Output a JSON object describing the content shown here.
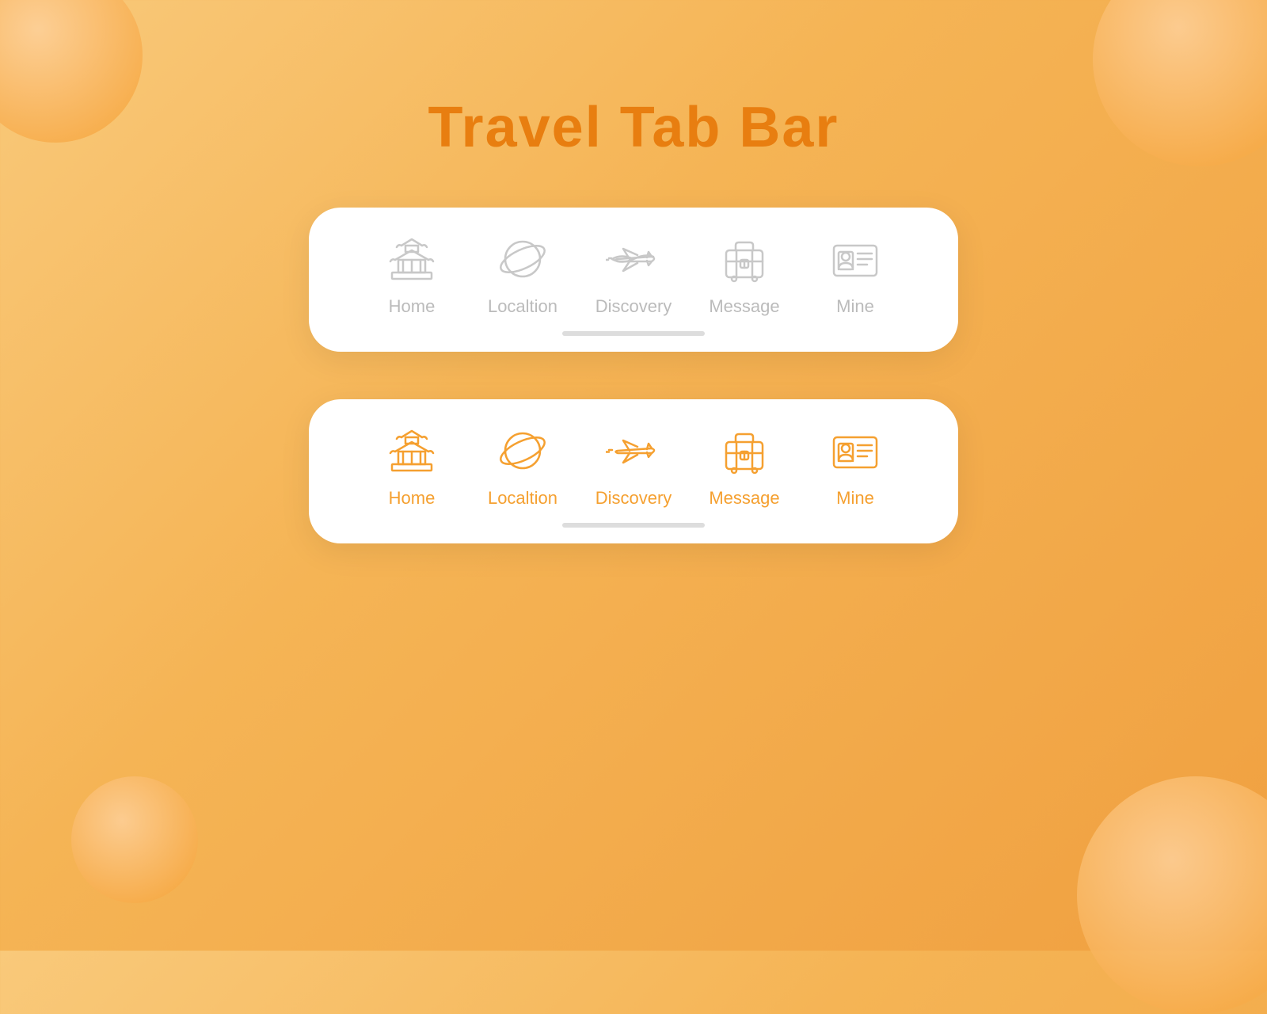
{
  "page": {
    "title": "Travel Tab Bar",
    "background_color": "#f5b455",
    "accent_color": "#f5a030",
    "inactive_color": "#c8c8c8"
  },
  "tab_bar_inactive": {
    "tabs": [
      {
        "id": "home",
        "label": "Home"
      },
      {
        "id": "location",
        "label": "Localtion"
      },
      {
        "id": "discovery",
        "label": "Discovery"
      },
      {
        "id": "message",
        "label": "Message"
      },
      {
        "id": "mine",
        "label": "Mine"
      }
    ]
  },
  "tab_bar_active": {
    "tabs": [
      {
        "id": "home",
        "label": "Home"
      },
      {
        "id": "location",
        "label": "Localtion"
      },
      {
        "id": "discovery",
        "label": "Discovery"
      },
      {
        "id": "message",
        "label": "Message"
      },
      {
        "id": "mine",
        "label": "Mine"
      }
    ]
  }
}
